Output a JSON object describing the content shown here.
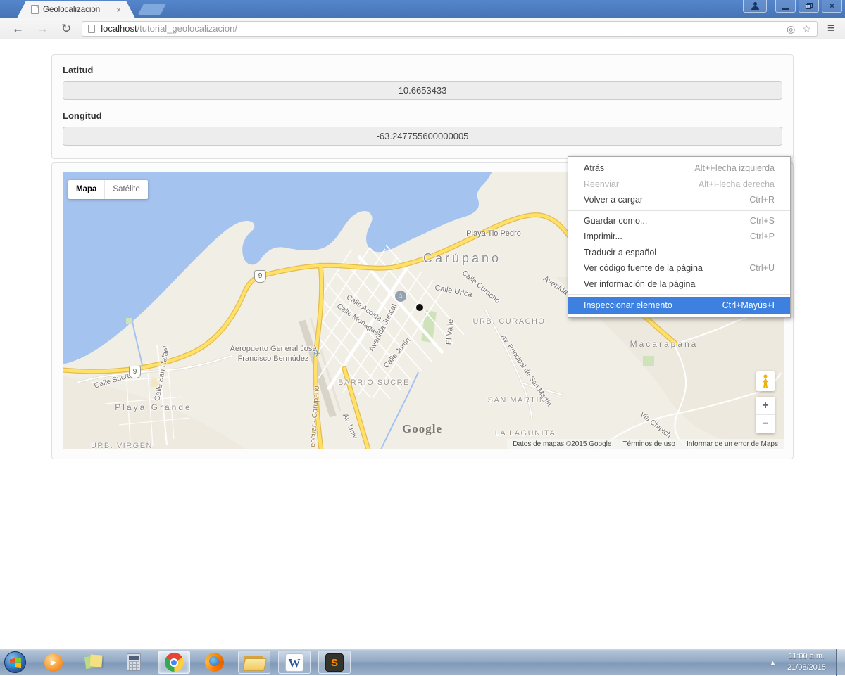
{
  "browser": {
    "tab_title": "Geolocalizacion",
    "url": {
      "host": "localhost",
      "path": "/tutorial_geolocalizacion/"
    },
    "icons": {
      "back": "←",
      "forward": "→",
      "reload": "↻",
      "geolocation": "◎",
      "bookmark_star": "☆",
      "menu": "≡",
      "tab_close": "×",
      "close": "×"
    }
  },
  "page": {
    "latitude": {
      "label": "Latitud",
      "value": "10.6653433"
    },
    "longitude": {
      "label": "Longitud",
      "value": "-63.247755600000005"
    }
  },
  "map": {
    "type_controls": {
      "map": "Mapa",
      "satellite": "Satélite"
    },
    "zoom_controls": {
      "zoom_in": "+",
      "zoom_out": "−"
    },
    "route_shield": "9",
    "google_logo": "Google",
    "attribution": {
      "data": "Datos de mapas ©2015 Google",
      "terms": "Términos de uso",
      "report": "Informar de un error de Maps"
    },
    "labels": {
      "playa_tio_pedro": "Playa Tio Pedro",
      "carupano": "Carúpano",
      "avenida": "Avenida",
      "calle_urica": "Calle Urica",
      "calle_curacho": "Calle Curacho",
      "calle_acosta": "Calle Acosta",
      "calle_monagas": "Calle Monagas",
      "avenida_juncal": "Avenida Juncal",
      "calle_junin": "Calle Junín",
      "el_valle": "El Valle",
      "urb_curacho": "URB. CURACHO",
      "av_principal_san_martin": "Av. Principal de San Martín",
      "san_martin": "SAN MARTIN",
      "la_lagunita": "LA LAGUNITA",
      "barrio_sucre": "BARRIO SUCRE",
      "macarapana": "Macarapana",
      "via_chipich": "Via Chipich",
      "playa_grande": "Playa Grande",
      "calle_sucre": "Calle Sucre",
      "calle_san_rafael": "Calle San Rafael",
      "urb_virgen": "URB. VIRGEN",
      "aeropuerto": "Aeropuerto General José Francisco Bermúdez",
      "carretera_carupano": "eocuar - Carupano",
      "av_universitaria": "Av. Univ",
      "house_poi": "⌂",
      "plane_poi": "✈"
    }
  },
  "context_menu": {
    "items": [
      {
        "label": "Atrás",
        "shortcut": "Alt+Flecha izquierda"
      },
      {
        "label": "Reenviar",
        "shortcut": "Alt+Flecha derecha"
      },
      {
        "label": "Volver a cargar",
        "shortcut": "Ctrl+R"
      },
      {
        "separator": true
      },
      {
        "label": "Guardar como...",
        "shortcut": "Ctrl+S"
      },
      {
        "label": "Imprimir...",
        "shortcut": "Ctrl+P"
      },
      {
        "label": "Traducir a español",
        "shortcut": ""
      },
      {
        "label": "Ver código fuente de la página",
        "shortcut": "Ctrl+U"
      },
      {
        "label": "Ver información de la página",
        "shortcut": ""
      },
      {
        "separator": true
      },
      {
        "label": "Inspeccionar elemento",
        "shortcut": "Ctrl+Mayús+I"
      }
    ]
  },
  "taskbar": {
    "clock": {
      "time": "11:00 a.m.",
      "date": "21/08/2015"
    },
    "icons": [
      "start",
      "windows-media-player",
      "sticky-notes",
      "calculator",
      "chrome",
      "firefox",
      "windows-explorer",
      "word",
      "sublime-text"
    ],
    "wmp_glyph": "▶"
  },
  "colors": {
    "titlebar": "#4b7cc3",
    "menu_highlight": "#3d80df",
    "water": "#a4c3ee",
    "land": "#f1eee6",
    "road_yellow": "#ffe069"
  }
}
